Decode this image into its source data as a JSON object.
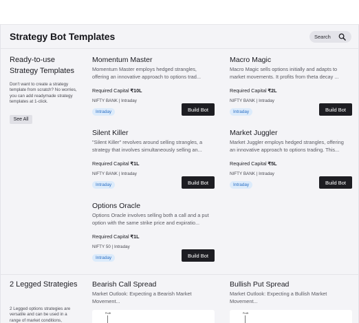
{
  "header": {
    "title": "Strategy Bot Templates",
    "search_label": "Search"
  },
  "ready_section": {
    "title": "Ready-to-use Strategy Templates",
    "description": "Don't want to create a strategy template from scratch? No worries, you can add readymade strategy templates at 1-click.",
    "see_all": "See All"
  },
  "legged_section": {
    "title": "2 Legged Strategies",
    "description": "2 Legged options strategies are versatile and can be used in a range of market conditions,"
  },
  "cards": [
    {
      "name": "Momentum Master",
      "description": "Momentum Master employs hedged strangles, offering an innovative approach to options trad...",
      "capital_label": "Required Capital",
      "capital": "₹10L",
      "meta": "NIFTY BANK | Intraday",
      "tag": "Intraday",
      "button": "Build Bot"
    },
    {
      "name": "Macro Magic",
      "description": "Macro Magic sells options initially and adapts to market movements. It profits from theta decay ...",
      "capital_label": "Required Capital",
      "capital": "₹2L",
      "meta": "NIFTY BANK | Intraday",
      "tag": "Intraday",
      "button": "Build Bot"
    },
    {
      "name": "Silent Killer",
      "description": "\"Silent Killer\" revolves around selling strangles, a strategy that involves simultaneously selling an...",
      "capital_label": "Required Capital",
      "capital": "₹1L",
      "meta": "NIFTY BANK | Intraday",
      "tag": "Intraday",
      "button": "Build Bot"
    },
    {
      "name": "Market Juggler",
      "description": "Market Juggler employs hedged strangles, offering an innovative approach to options trading. This...",
      "capital_label": "Required Capital",
      "capital": "₹5L",
      "meta": "NIFTY BANK | Intraday",
      "tag": "Intraday",
      "button": "Build Bot"
    },
    {
      "name": "Options Oracle",
      "description": "Options Oracle involves selling both a call and a put option with the same strike price and expiratio...",
      "capital_label": "Required Capital",
      "capital": "₹1L",
      "meta": "NIFTY 50 | Intraday",
      "tag": "Intraday",
      "button": "Build Bot"
    }
  ],
  "legged_cards": [
    {
      "name": "Bearish Call Spread",
      "description": "Market Outlook: Expecting a Bearish Market Movement...",
      "preview_label": "Profit"
    },
    {
      "name": "Bullish Put Spread",
      "description": "Market Outlook: Expecting a Bullish Market Movement...",
      "preview_label": "Profit"
    }
  ],
  "colors": {
    "button_bg": "#1d1d22",
    "tag_bg": "#dcebfb",
    "tag_text": "#2b6fc4",
    "page_bg": "#f4f4f7"
  },
  "icons": {
    "search": "search-icon"
  }
}
